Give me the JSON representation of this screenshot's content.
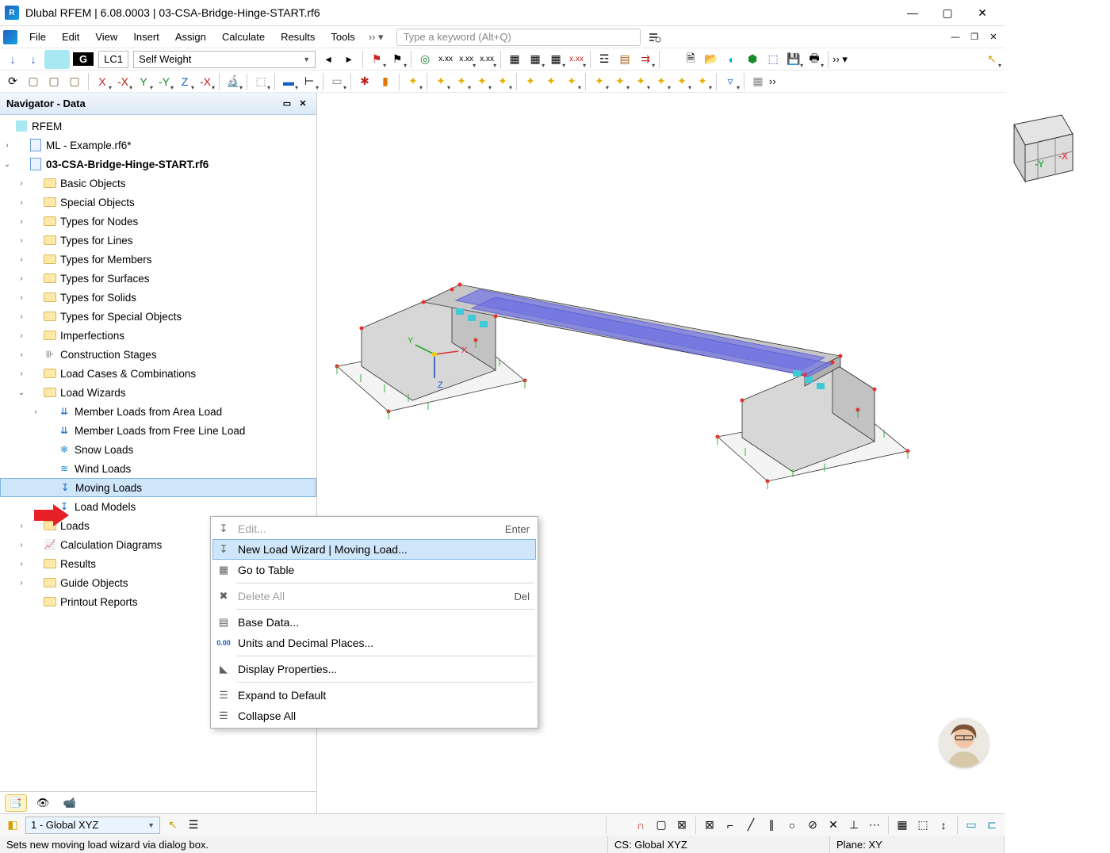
{
  "window": {
    "title": "Dlubal RFEM | 6.08.0003 | 03-CSA-Bridge-Hinge-START.rf6"
  },
  "menu": {
    "items": [
      "File",
      "Edit",
      "View",
      "Insert",
      "Assign",
      "Calculate",
      "Results",
      "Tools"
    ],
    "search_placeholder": "Type a keyword (Alt+Q)"
  },
  "ribbon": {
    "loadcase_code": "LC1",
    "loadcase_name": "Self Weight",
    "coord_badge": "G",
    "num1": "x.xx",
    "num2": "x.xx"
  },
  "navigator": {
    "title": "Navigator - Data",
    "root": "RFEM",
    "files": [
      {
        "label": "ML - Example.rf6*",
        "bold": false
      },
      {
        "label": "03-CSA-Bridge-Hinge-START.rf6",
        "bold": true
      }
    ],
    "folders": [
      "Basic Objects",
      "Special Objects",
      "Types for Nodes",
      "Types for Lines",
      "Types for Members",
      "Types for Surfaces",
      "Types for Solids",
      "Types for Special Objects",
      "Imperfections",
      "Construction Stages",
      "Load Cases & Combinations"
    ],
    "load_wizards_label": "Load Wizards",
    "load_wizards": [
      "Member Loads from Area Load",
      "Member Loads from Free Line Load",
      "Snow Loads",
      "Wind Loads",
      "Moving Loads",
      "Load Models"
    ],
    "folders_after": [
      "Loads",
      "Calculation Diagrams",
      "Results",
      "Guide Objects",
      "Printout Reports"
    ]
  },
  "context_menu": {
    "items": [
      {
        "label": "Edit...",
        "shortcut": "Enter",
        "disabled": true
      },
      {
        "label": "New Load Wizard | Moving Load...",
        "highlight": true
      },
      {
        "label": "Go to Table"
      },
      {
        "sep": true
      },
      {
        "label": "Delete All",
        "shortcut": "Del",
        "disabled": true
      },
      {
        "sep": true
      },
      {
        "label": "Base Data..."
      },
      {
        "label": "Units and Decimal Places..."
      },
      {
        "sep": true
      },
      {
        "label": "Display Properties..."
      },
      {
        "sep": true
      },
      {
        "label": "Expand to Default"
      },
      {
        "label": "Collapse All"
      }
    ]
  },
  "bottom": {
    "coord_system": "1 - Global XYZ"
  },
  "status": {
    "hint": "Sets new moving load wizard via dialog box.",
    "cs": "CS: Global XYZ",
    "plane": "Plane: XY"
  },
  "cube": {
    "x": "-X",
    "y": "-Y"
  }
}
